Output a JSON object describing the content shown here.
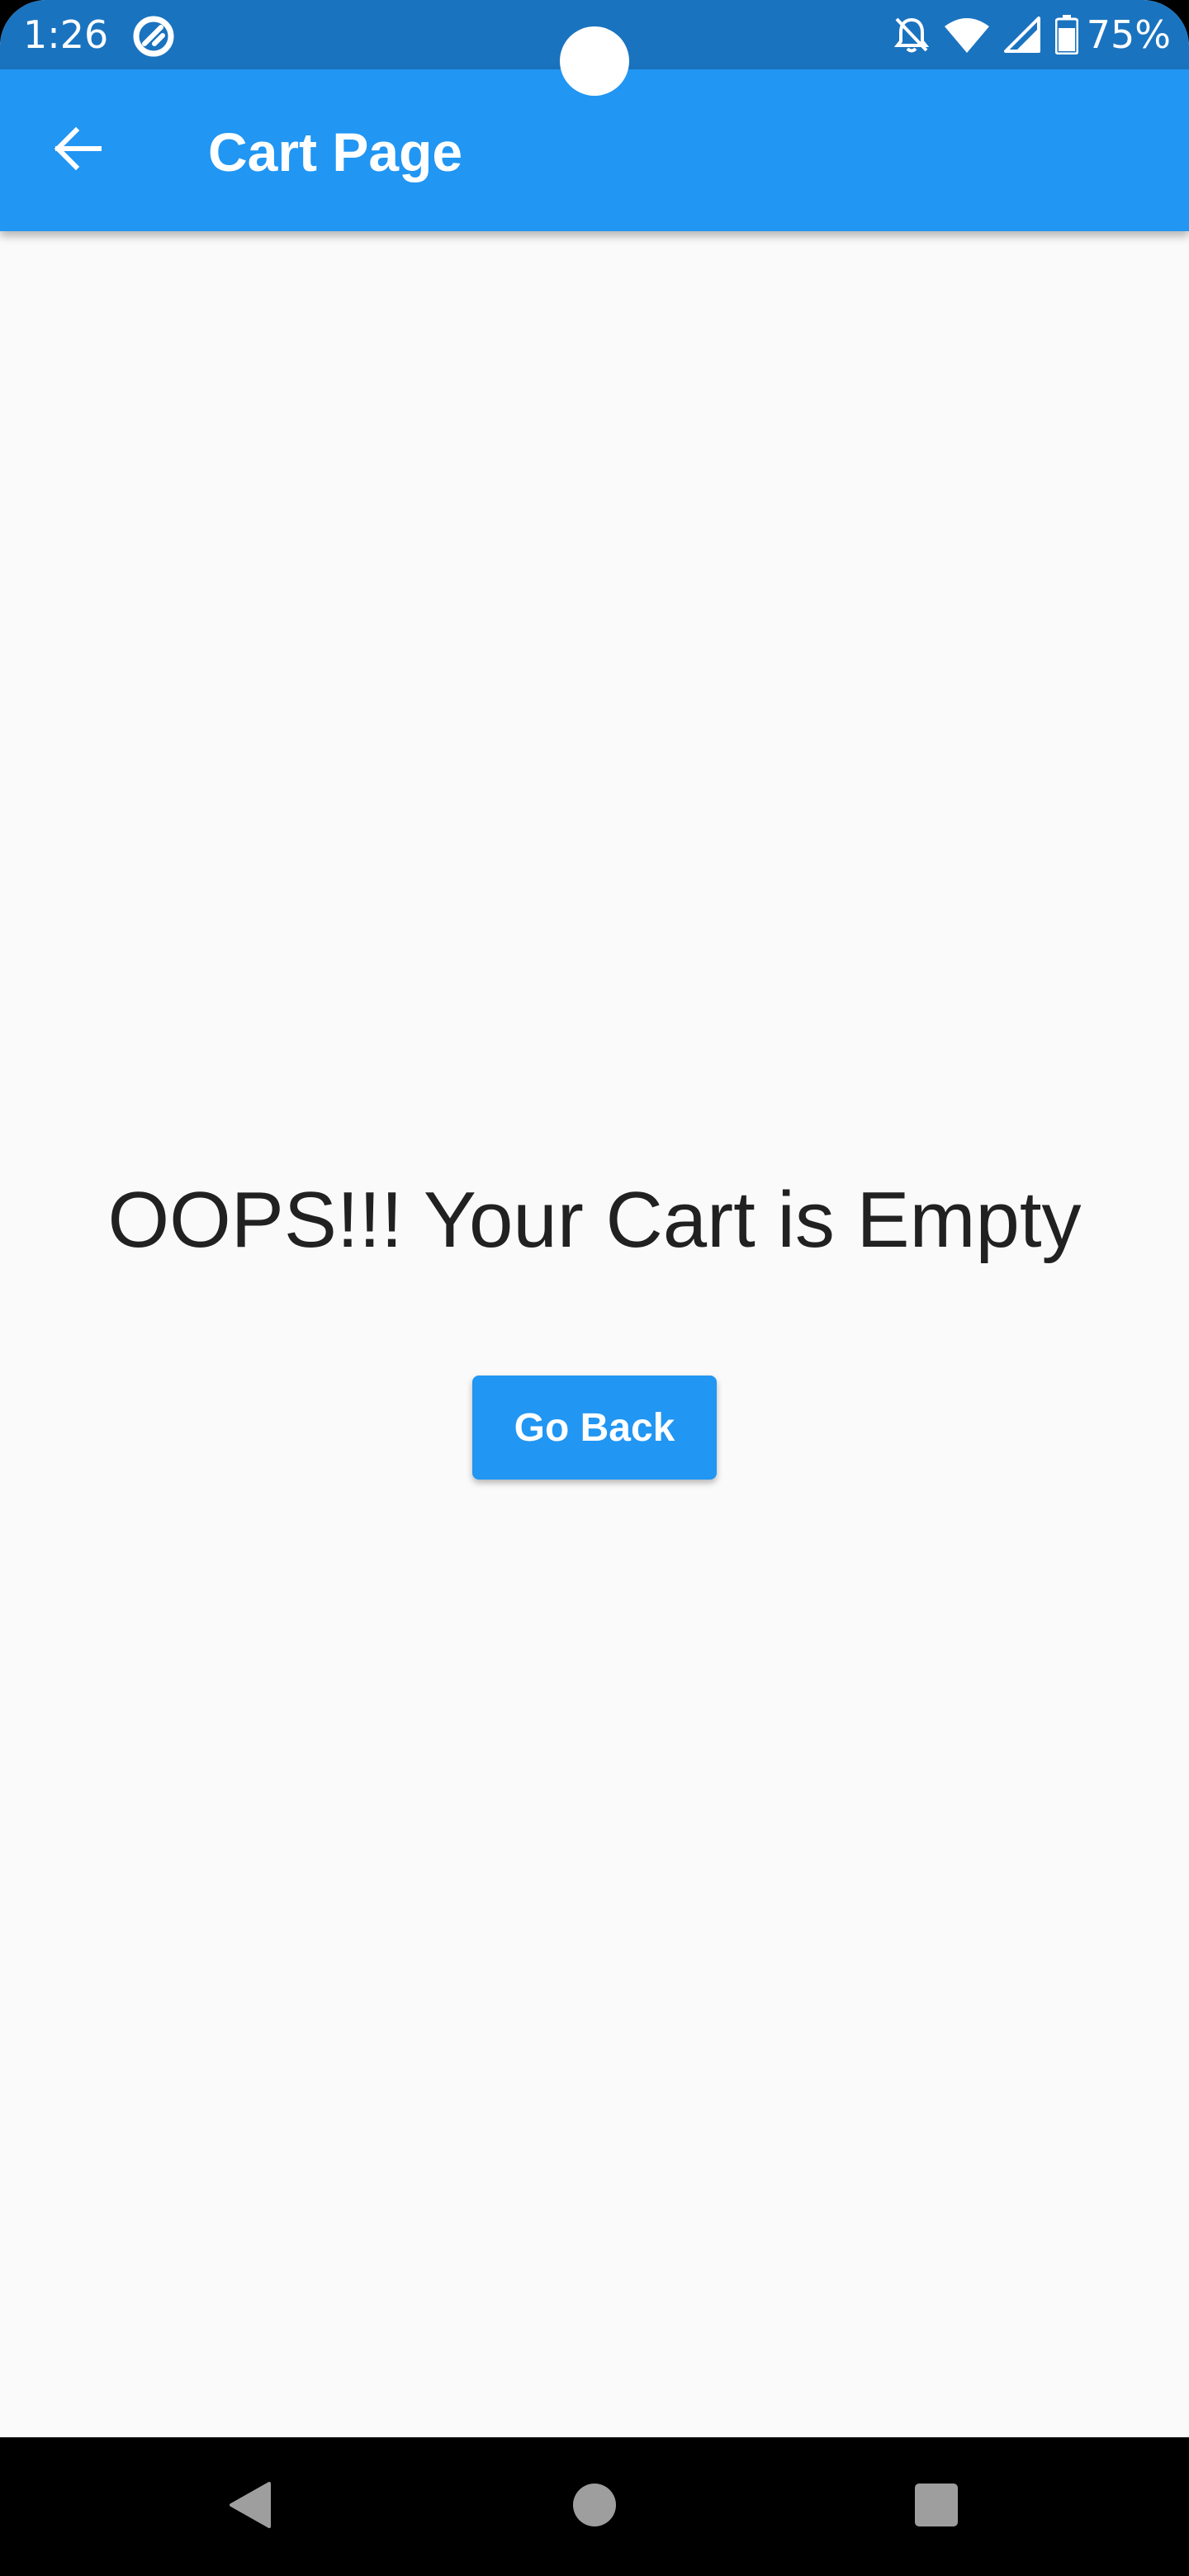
{
  "status_bar": {
    "time": "1:26",
    "battery_percent": "75%",
    "icons": [
      "app-notification-icon",
      "bell-off-icon",
      "wifi-icon",
      "cell-signal-icon",
      "battery-icon"
    ]
  },
  "app_bar": {
    "title": "Cart Page",
    "back_icon": "arrow-back-icon"
  },
  "main": {
    "empty_message": "OOPS!!! Your Cart is Empty",
    "go_back_label": "Go Back"
  },
  "nav_bar": {
    "icons": [
      "nav-back-icon",
      "nav-home-icon",
      "nav-recents-icon"
    ]
  },
  "colors": {
    "status_bar": "#1a73bf",
    "app_bar": "#2196f3",
    "background": "#fafafa",
    "text": "#212121",
    "button": "#2196f3"
  }
}
